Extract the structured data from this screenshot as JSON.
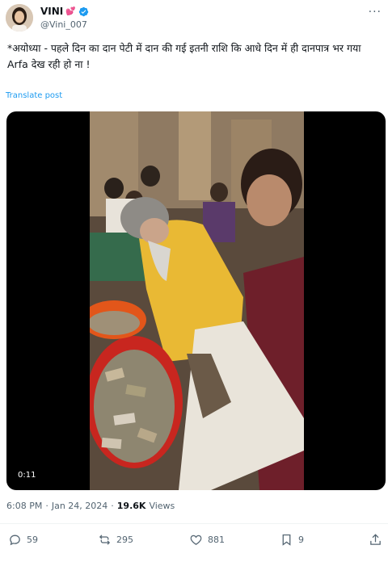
{
  "user": {
    "name": "VINI",
    "name_emoji": "💕",
    "handle": "@Vini_007",
    "verified": true
  },
  "menu": {
    "more_label": "···"
  },
  "tweet": {
    "line1": "*अयोध्या - पहले दिन का दान पेटी में दान की गई इतनी राशि कि आधे दिन में ही दानपात्र भर गया",
    "line2": "Arfa देख रही हो ना !",
    "translate_label": "Translate post"
  },
  "video": {
    "duration": "0:11"
  },
  "meta": {
    "time": "6:08 PM",
    "sep": "·",
    "date": "Jan 24, 2024",
    "sep2": "·",
    "views_count": "19.6K",
    "views_label": "Views"
  },
  "actions": {
    "replies": "59",
    "reposts": "295",
    "likes": "881",
    "bookmarks": "9"
  },
  "colors": {
    "accent": "#1d9bf0",
    "muted": "#536471",
    "text": "#0f1419"
  }
}
